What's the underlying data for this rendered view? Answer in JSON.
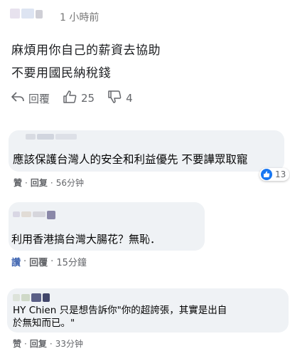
{
  "comment1": {
    "time": "1 小時前",
    "lines": [
      "麻煩用你自己的薪資去協助",
      "不要用國民納稅錢"
    ],
    "reply_label": "回覆",
    "like_count": "25",
    "dislike_count": "4"
  },
  "comment2": {
    "text": "應該保護台灣人的安全和利益優先 不要譁眾取寵",
    "reaction_count": "13",
    "like_label": "贊",
    "reply_label": "回复",
    "time": "56分钟"
  },
  "comment3": {
    "text": "利用香港搞台灣大腸花？無恥．",
    "like_label": "讚",
    "reply_label": "回覆",
    "time": "15分鐘"
  },
  "comment4": {
    "line1": "HY Chien 只是想告訴你\"你的超誇張，其實是出自",
    "line2": "於無知而已。\"",
    "like_label": "赞",
    "reply_label": "回复",
    "time": "33分钟"
  },
  "colors": {
    "accent": "#1877f2",
    "bubble": "#eff2f5",
    "muted": "#65676b"
  }
}
